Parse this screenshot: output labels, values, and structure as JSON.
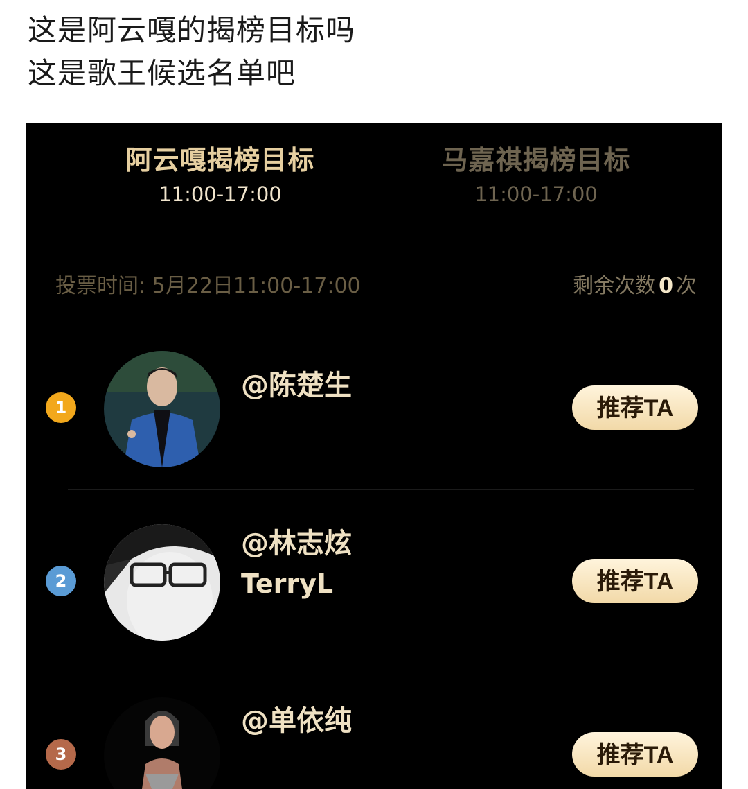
{
  "captions": [
    "这是阿云嘎的揭榜目标吗",
    "这是歌王候选名单吧"
  ],
  "tabs": [
    {
      "title": "阿云嘎揭榜目标",
      "time": "11:00-17:00"
    },
    {
      "title": "马嘉祺揭榜目标",
      "time": "11:00-17:00"
    }
  ],
  "vote": {
    "time_label": "投票时间: 5月22日11:00-17:00",
    "remaining_prefix": "剩余次数",
    "remaining_count": "0",
    "remaining_suffix": "次"
  },
  "candidates": [
    {
      "rank": "1",
      "name": "@陈楚生",
      "sub": "",
      "button": "推荐TA",
      "rank_color": "#f2a81c"
    },
    {
      "rank": "2",
      "name": "@林志炫",
      "sub": "TerryL",
      "button": "推荐TA",
      "rank_color": "#5a9bd5"
    },
    {
      "rank": "3",
      "name": "@单依纯",
      "sub": "",
      "button": "推荐TA",
      "rank_color": "#b5694a"
    }
  ]
}
